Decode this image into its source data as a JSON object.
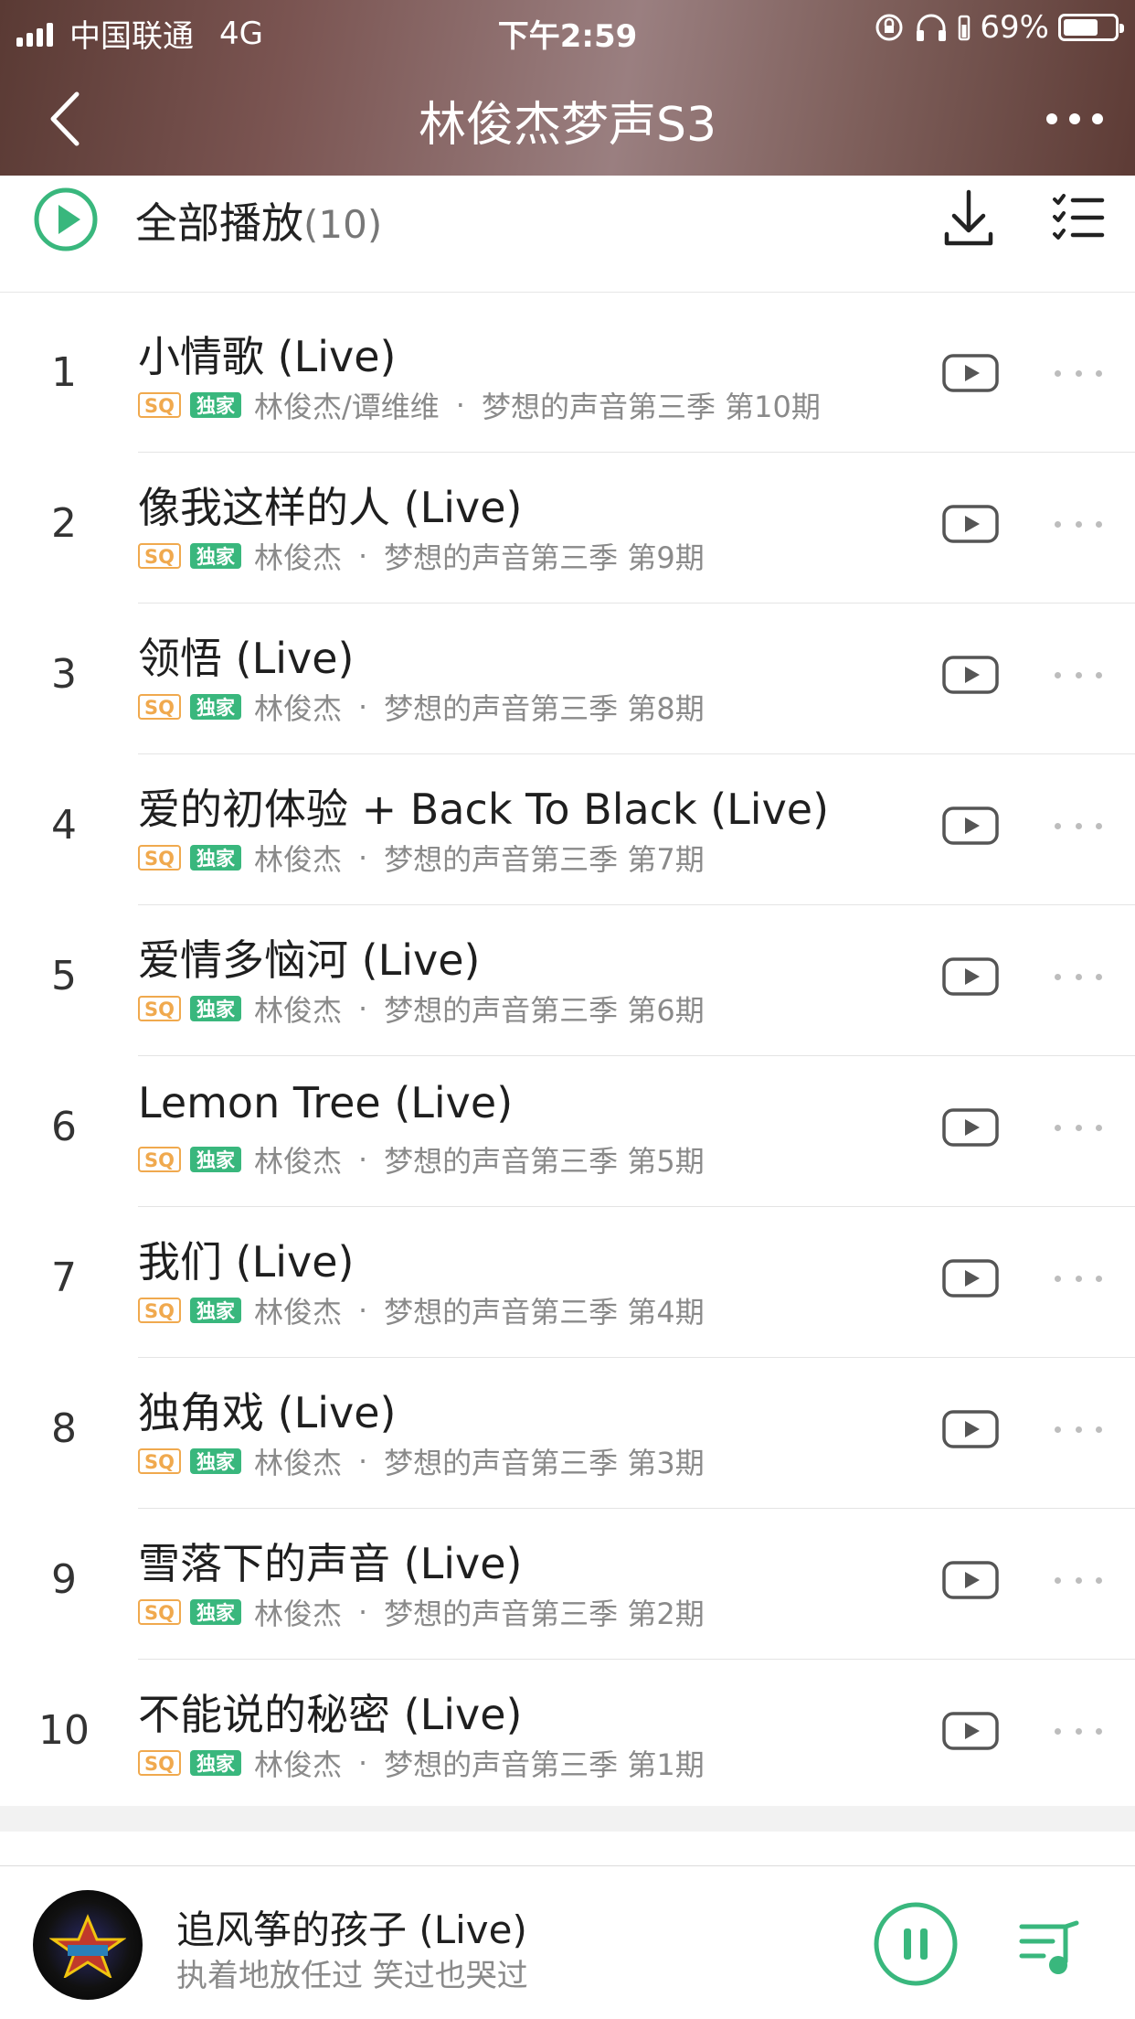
{
  "status_bar": {
    "carrier": "中国联通",
    "network": "4G",
    "time": "下午2:59",
    "battery_percent_label": "69%",
    "battery_level": 0.69
  },
  "header": {
    "title": "林俊杰梦声S3",
    "back_icon": "chevron-left-icon",
    "more_icon": "more-horizontal-icon",
    "background_colors": [
      "#5a3a34",
      "#9a7f80"
    ]
  },
  "play_all": {
    "label": "全部播放",
    "count": "(10)",
    "accent_color": "#39b77d"
  },
  "songs": [
    {
      "num": "1",
      "title": "小情歌 (Live)",
      "sq": "SQ",
      "exclusive": "独家",
      "artist": "林俊杰/谭维维",
      "separator": "·",
      "album": "梦想的声音第三季 第10期"
    },
    {
      "num": "2",
      "title": "像我这样的人 (Live)",
      "sq": "SQ",
      "exclusive": "独家",
      "artist": "林俊杰",
      "separator": "·",
      "album": "梦想的声音第三季 第9期"
    },
    {
      "num": "3",
      "title": "领悟 (Live)",
      "sq": "SQ",
      "exclusive": "独家",
      "artist": "林俊杰",
      "separator": "·",
      "album": "梦想的声音第三季 第8期"
    },
    {
      "num": "4",
      "title": "爱的初体验 + Back To Black (Live)",
      "sq": "SQ",
      "exclusive": "独家",
      "artist": "林俊杰",
      "separator": "·",
      "album": "梦想的声音第三季 第7期"
    },
    {
      "num": "5",
      "title": "爱情多恼河 (Live)",
      "sq": "SQ",
      "exclusive": "独家",
      "artist": "林俊杰",
      "separator": "·",
      "album": "梦想的声音第三季 第6期"
    },
    {
      "num": "6",
      "title": "Lemon Tree (Live)",
      "sq": "SQ",
      "exclusive": "独家",
      "artist": "林俊杰",
      "separator": "·",
      "album": "梦想的声音第三季 第5期"
    },
    {
      "num": "7",
      "title": "我们 (Live)",
      "sq": "SQ",
      "exclusive": "独家",
      "artist": "林俊杰",
      "separator": "·",
      "album": "梦想的声音第三季 第4期"
    },
    {
      "num": "8",
      "title": "独角戏 (Live)",
      "sq": "SQ",
      "exclusive": "独家",
      "artist": "林俊杰",
      "separator": "·",
      "album": "梦想的声音第三季 第3期"
    },
    {
      "num": "9",
      "title": "雪落下的声音 (Live)",
      "sq": "SQ",
      "exclusive": "独家",
      "artist": "林俊杰",
      "separator": "·",
      "album": "梦想的声音第三季 第2期"
    },
    {
      "num": "10",
      "title": "不能说的秘密 (Live)",
      "sq": "SQ",
      "exclusive": "独家",
      "artist": "林俊杰",
      "separator": "·",
      "album": "梦想的声音第三季 第1期"
    }
  ],
  "now_playing": {
    "title": "追风筝的孩子 (Live)",
    "lyric": "执着地放任过 笑过也哭过",
    "state": "playing"
  },
  "icons": {
    "play_all": "play-circle-icon",
    "download": "download-icon",
    "multi_select": "multi-select-list-icon",
    "mv": "video-play-icon",
    "row_more": "more-dots-icon",
    "pause": "pause-circle-icon",
    "queue": "playlist-icon"
  }
}
